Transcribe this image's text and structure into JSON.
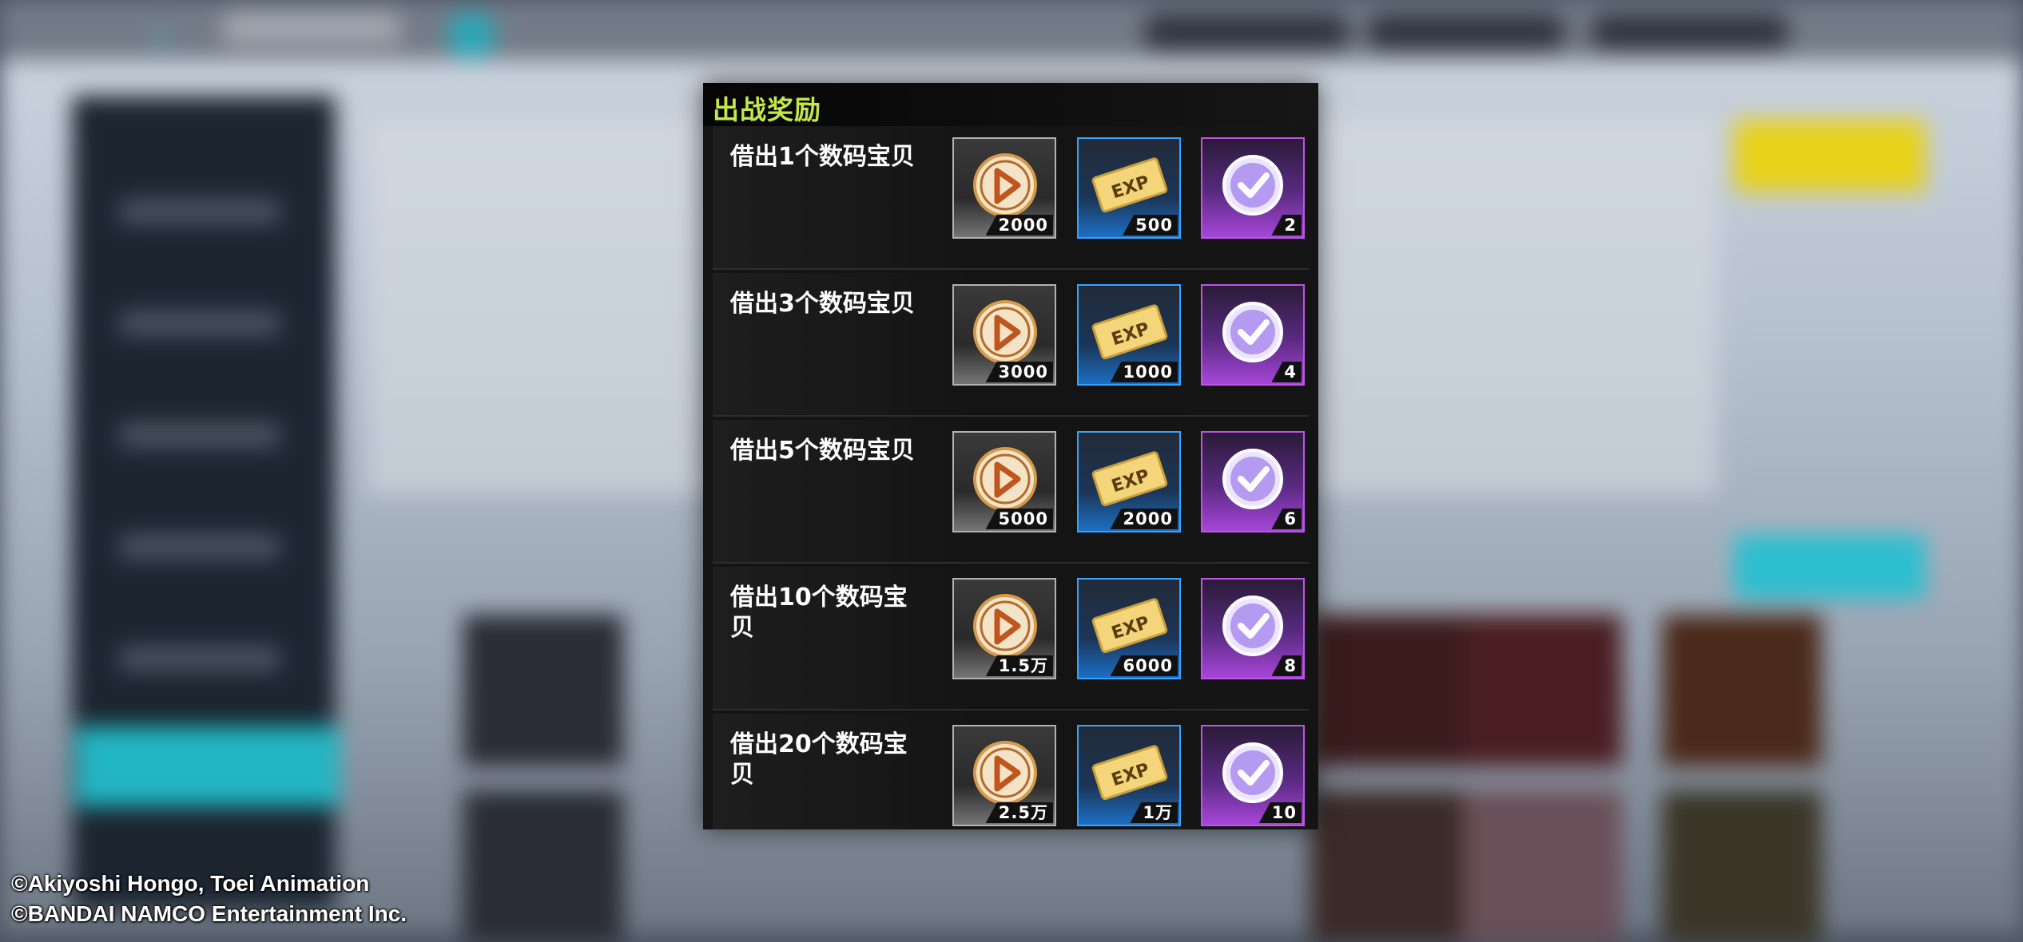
{
  "dialog": {
    "title": "出战奖励",
    "rows": [
      {
        "label": "借出1个数码宝贝",
        "coin": "2000",
        "exp": "500",
        "chip": "2"
      },
      {
        "label": "借出3个数码宝贝",
        "coin": "3000",
        "exp": "1000",
        "chip": "4"
      },
      {
        "label": "借出5个数码宝贝",
        "coin": "5000",
        "exp": "2000",
        "chip": "6"
      },
      {
        "label": "借出10个数码宝贝",
        "coin": "1.5万",
        "exp": "6000",
        "chip": "8"
      },
      {
        "label": "借出20个数码宝贝",
        "coin": "2.5万",
        "exp": "1万",
        "chip": "10"
      }
    ],
    "item_icons": [
      "coin-icon",
      "exp-ticket-icon",
      "check-chip-icon"
    ],
    "colors": {
      "title": "#c4e84a",
      "coin_frame": "#b2b2b2",
      "exp_frame": "#35a4ff",
      "chip_frame": "#c053e8"
    }
  },
  "copyright": {
    "line1": "©Akiyoshi Hongo, Toei Animation",
    "line2": "©BANDAI NAMCO Entertainment Inc."
  }
}
